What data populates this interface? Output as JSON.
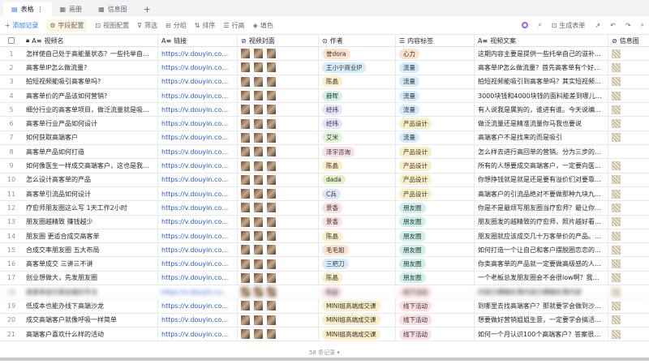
{
  "tabs": [
    {
      "label": "表格",
      "icon": "table-icon",
      "active": true
    },
    {
      "label": "画册",
      "icon": "gallery-icon"
    },
    {
      "label": "信息图",
      "icon": "gallery-icon"
    }
  ],
  "toolbar": {
    "add": "+ 添加记录",
    "field_config": "字段配置",
    "view_config": "视图配置",
    "filter": "筛选",
    "group": "分组",
    "sort": "排序",
    "row_height": "行高",
    "color": "填色",
    "generate_form": "生成表单"
  },
  "columns": [
    "视频名",
    "链接",
    "视频封面",
    "作者",
    "内容标签",
    "视频文案",
    "信息图"
  ],
  "rows": [
    {
      "n": "1",
      "name": "怎样使自己处于高能量状态？一些托举自己的...",
      "link": "https://v.douyin.com/k8...",
      "author": "誉dora",
      "ac": "#fde3cf",
      "tag": "心力",
      "tc": "#fde3cf",
      "copy": "这期内容主要是提供一些托举自己的滋补...",
      "qr": true
    },
    {
      "n": "2",
      "name": "高客单IP怎么做流量?",
      "link": "https://v.douyin.com/Va...",
      "author": "王小宁商业IP",
      "ac": "#d4ecfb",
      "tag": "流量",
      "tc": "#d4ecfb",
      "copy": "高客单IP怎么做流量？首先高客单有个好处...",
      "qr": true
    },
    {
      "n": "3",
      "name": "拍短视频能吸引高客单吗?",
      "link": "https://v.douyin.com/yQ...",
      "author": "陈晶",
      "ac": "#fcefc7",
      "tag": "流量",
      "tc": "#d4ecfb",
      "copy": "拍短视频能吸引到高客单吗？其实短视频想...",
      "qr": true
    },
    {
      "n": "4",
      "name": "高客单价的产品该如何营销?",
      "link": "https://v.douyin.com/qj...",
      "author": "薛晖",
      "ac": "#d2f2ea",
      "tag": "流量",
      "tc": "#d4ecfb",
      "copy": "3000块钱和4000块钱的面料能差到哪儿去呢...",
      "qr": true
    },
    {
      "n": "5",
      "name": "细分行业的高客单项目，做泛流量就是吸引不...",
      "link": "https://v.douyin.com/3H...",
      "author": "经纬",
      "ac": "#ebe3fb",
      "tag": "流量",
      "tc": "#d4ecfb",
      "copy": "有人说我是属狗的，谁进有谁。今天说编导...",
      "qr": true
    },
    {
      "n": "6",
      "name": "高客单行业产品如何设计",
      "link": "https://v.douyin.com/i2...",
      "author": "经纬",
      "ac": "#ebe3fb",
      "tag": "产品设计",
      "tc": "#fcefc7",
      "copy": "做泛流量还是精准流量你马我也要说",
      "qr": true
    },
    {
      "n": "7",
      "name": "如何获取高端客户",
      "link": "https://v.douyin.com/f9...",
      "author": "艾米",
      "ac": "#dff3d6",
      "tag": "流量",
      "tc": "#d4ecfb",
      "copy": "高端客户不是找来的而是吸引",
      "qr": true
    },
    {
      "n": "8",
      "name": "高客单产品如何打造",
      "link": "https://v.douyin.com/lls...",
      "author": "泽宇咨询",
      "ac": "#fbdfe7",
      "tag": "产品设计",
      "tc": "#fcefc7",
      "copy": "怎么样去进行高回单的营销。分为三步的，...",
      "qr": false
    },
    {
      "n": "9",
      "name": "如何像医生一样成交高端客户，这也是我们的...",
      "link": "https://v.douyin.com/do...",
      "author": "陈晶",
      "ac": "#fcefc7",
      "tag": "产品设计",
      "tc": "#fcefc7",
      "copy": "所有的人想要成交高端客户，一定要向医生...",
      "qr": true
    },
    {
      "n": "10",
      "name": "怎么设计高客单的产品",
      "link": "https://v.douyin.com/M...",
      "author": "dada",
      "ac": "#e2f2c8",
      "tag": "产品设计",
      "tc": "#fcefc7",
      "copy": "你想挣钱就是就是还是要有溢价们对要靠人...",
      "qr": true
    },
    {
      "n": "11",
      "name": "高客单引流品如何设计",
      "link": "https://v.douyin.com/Dq...",
      "author": "C兵",
      "ac": "#dfe6fb",
      "tag": "产品设计",
      "tc": "#fcefc7",
      "copy": "高端客户的引流品绝对不要做那种九块九的...",
      "qr": true
    },
    {
      "n": "12",
      "name": "疗愈师朋友圈这么写 1天工作2小时",
      "link": "https://v.douyin.com/Hh...",
      "author": "景香",
      "ac": "#fbdfe3",
      "tag": "朋友圈",
      "tc": "#cdf0ea",
      "copy": "你是不是最烦写朋友圈当疗愈师？最让你崩...",
      "qr": true
    },
    {
      "n": "13",
      "name": "朋友圈越精致 赚钱越少",
      "link": "https://v.douyin.com/vh...",
      "author": "景香",
      "ac": "#fbdfe3",
      "tag": "朋友圈",
      "tc": "#cdf0ea",
      "copy": "朋友圈发的越精致的疗愈师，照片越好看，...",
      "qr": true
    },
    {
      "n": "14",
      "name": "朋友圈 更适合成交高客单",
      "link": "https://v.douyin.com/cR...",
      "author": "陈晶",
      "ac": "#fcefc7",
      "tag": "朋友圈",
      "tc": "#cdf0ea",
      "copy": "朋友圈就应该成交几十万客单价的产品。几...",
      "qr": true
    },
    {
      "n": "15",
      "name": "合成交率朋友圈 五大布局",
      "link": "https://v.douyin.com/kV...",
      "author": "毛毛姐",
      "ac": "#fde3cf",
      "tag": "朋友圈",
      "tc": "#cdf0ea",
      "copy": "如何打造一个让自己和客户摆脱圈恋恋的...",
      "qr": true
    },
    {
      "n": "16",
      "name": "高客单成交 三讲三不讲",
      "link": "https://v.douyin.com/Fu...",
      "author": "三把刀",
      "ac": "#d4ecfb",
      "tag": "朋友圈",
      "tc": "#cdf0ea",
      "copy": "你卖高客单的产品就一定要做高级感的人设...",
      "qr": true
    },
    {
      "n": "17",
      "name": "创业想做大，先发朋友圈",
      "link": "https://v.douyin.com/Xv...",
      "author": "陈晶",
      "ac": "#fcefc7",
      "tag": "朋友圈",
      "tc": "#cdf0ea",
      "copy": "一个老板总发朋友圈会不会很low啊？我觉得...",
      "qr": true
    },
    {
      "n": "18",
      "name": "高客单成交朋友圈的写法",
      "link": "https://v.douyin.com/xx...",
      "author": "陈晶",
      "ac": "#fbdfe3",
      "tag": "线下活动",
      "tc": "#fbdfe3",
      "copy": "内容已模糊处理内容已模糊处理内容",
      "qr": true,
      "blur": true
    },
    {
      "n": "19",
      "name": "低成本也能办线下高端沙龙",
      "link": "https://v.douyin.com/UP...",
      "author": "MINI姐高端成交课",
      "ac": "#fcefc7",
      "tag": "线下活动",
      "tc": "#fbdfe3",
      "copy": "到哪里去找高端客户？那就要学会做到沙活...",
      "qr": true
    },
    {
      "n": "20",
      "name": "成交高端客户就像呼吸一样简单",
      "link": "https://v.douyin.com/T5...",
      "author": "MINI姐高端成交课",
      "ac": "#fcefc7",
      "tag": "线下活动",
      "tc": "#fbdfe3",
      "copy": "想要做好营销姐姐生意，一定要学会搞活动...",
      "qr": true
    },
    {
      "n": "21",
      "name": "高端客户喜欢什么样的活动",
      "link": "https://v.douyin.com/sF...",
      "author": "MINI姐高端成交课",
      "ac": "#fcefc7",
      "tag": "线下活动",
      "tc": "#fbdfe3",
      "copy": "如何一个月认识100个高端客户？答案很简...",
      "qr": true
    }
  ],
  "footer": "58 条记录"
}
